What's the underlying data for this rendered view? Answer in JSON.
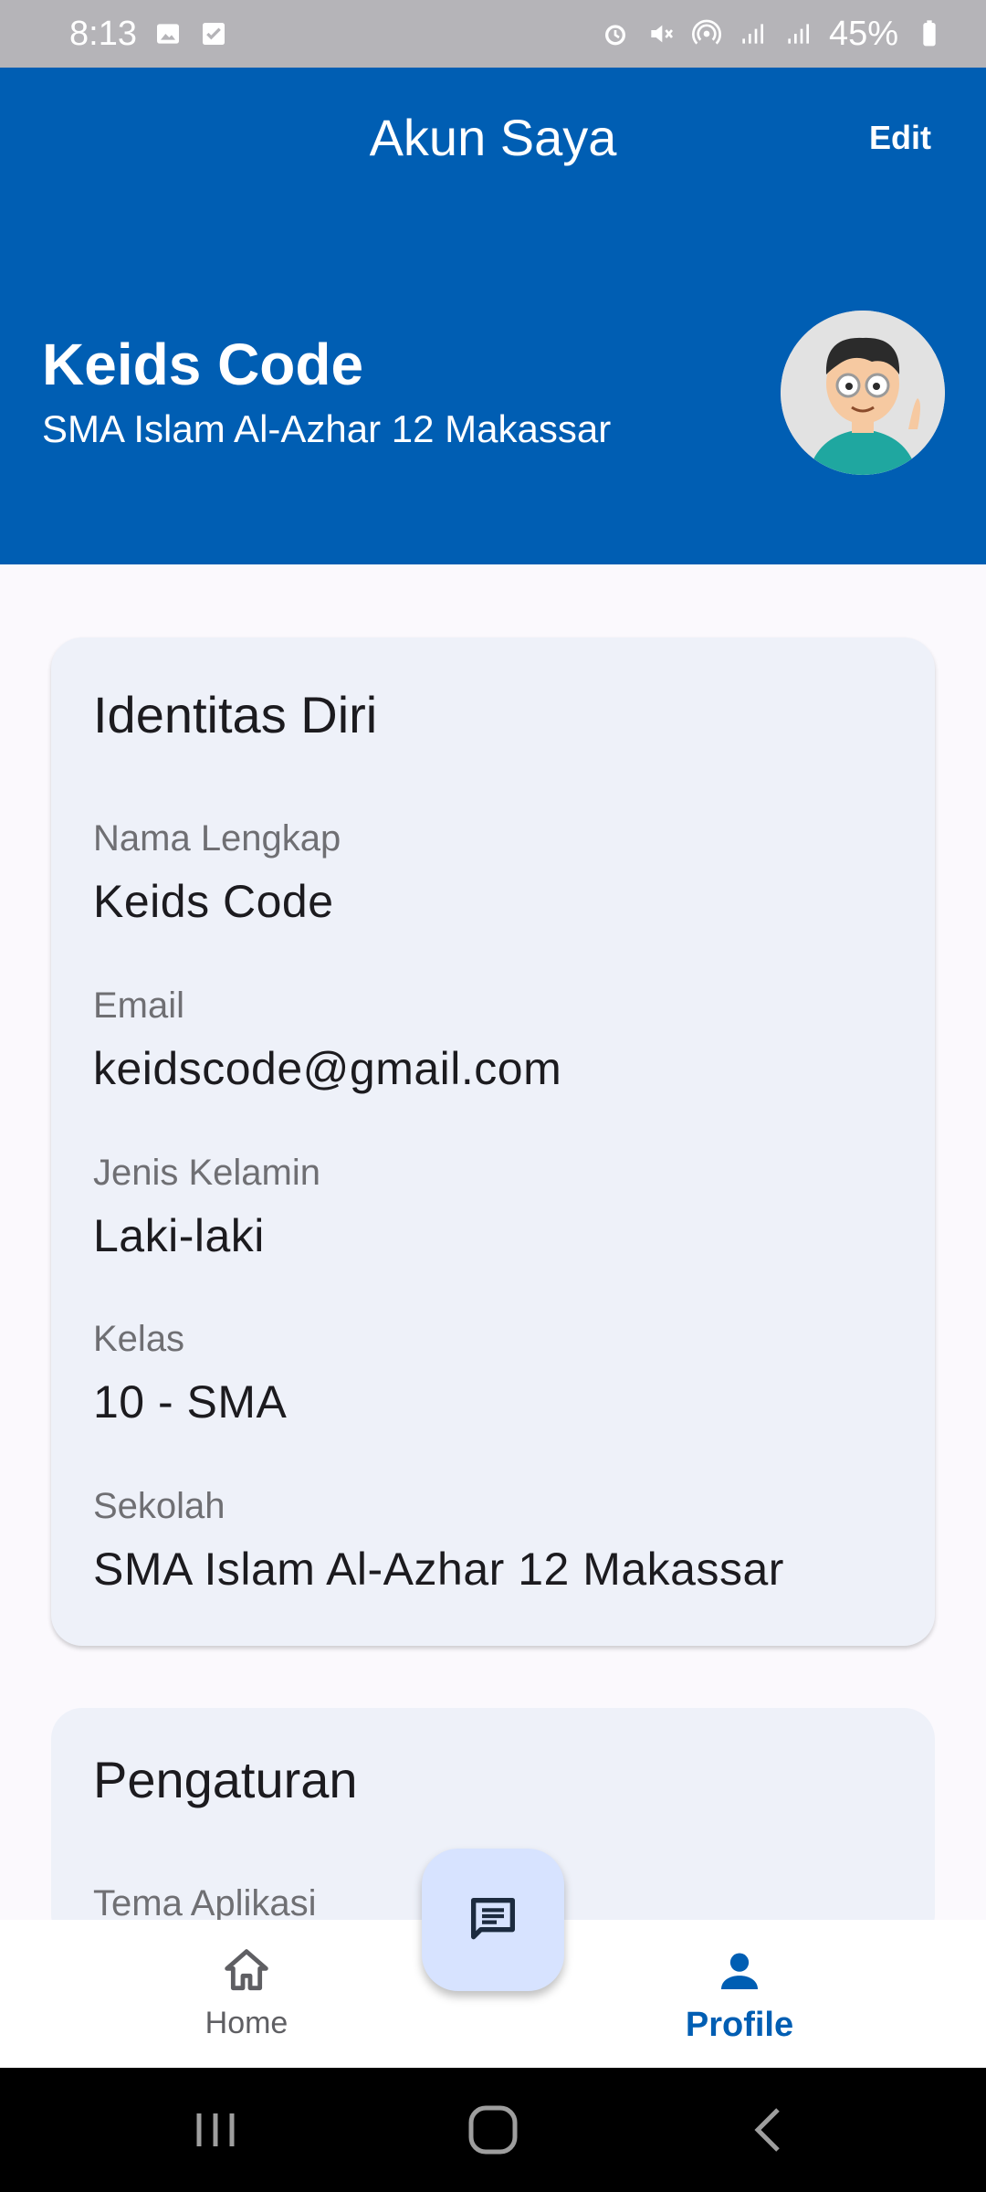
{
  "status_bar": {
    "time": "8:13",
    "battery": "45%",
    "icons_left": [
      "gallery-icon",
      "checkbox-icon"
    ],
    "icons_right": [
      "alarm-icon",
      "mute-icon",
      "hotspot-icon",
      "signal-icon",
      "signal-icon",
      "battery-icon"
    ]
  },
  "header": {
    "title": "Akun Saya",
    "edit_label": "Edit",
    "name": "Keids Code",
    "school": "SMA Islam Al-Azhar 12 Makassar",
    "background_color": "#005eb3"
  },
  "identity": {
    "title": "Identitas Diri",
    "fields": [
      {
        "label": "Nama Lengkap",
        "value": "Keids Code"
      },
      {
        "label": "Email",
        "value": "keidscode@gmail.com"
      },
      {
        "label": "Jenis Kelamin",
        "value": "Laki-laki"
      },
      {
        "label": "Kelas",
        "value": "10 - SMA"
      },
      {
        "label": "Sekolah",
        "value": "SMA Islam Al-Azhar 12 Makassar"
      }
    ]
  },
  "settings": {
    "title": "Pengaturan",
    "first_item_label": "Tema Aplikasi"
  },
  "bottom_nav": {
    "items": [
      {
        "label": "Home",
        "icon": "home-icon",
        "active": false
      },
      {
        "label": "Profile",
        "icon": "person-icon",
        "active": true
      }
    ],
    "fab_icon": "chat-icon",
    "active_color": "#005eb3"
  }
}
